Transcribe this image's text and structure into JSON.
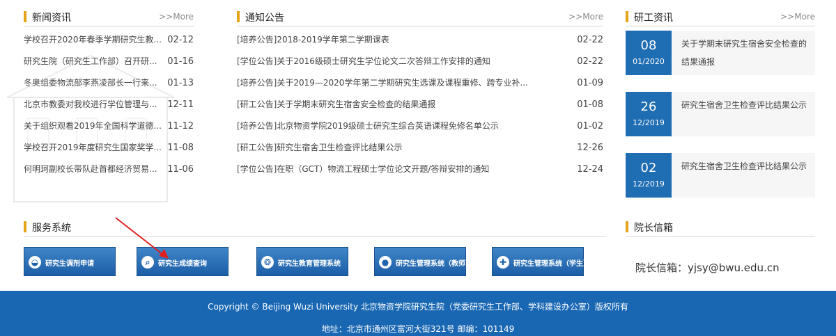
{
  "news": {
    "title": "新闻资讯",
    "more": ">>More",
    "items": [
      {
        "title": "学校召开2020年春季学期研究生教...",
        "date": "02-12"
      },
      {
        "title": "研究生院（研究生工作部）召开研...",
        "date": "01-16"
      },
      {
        "title": "冬奥组委物流部李燕凌部长一行来...",
        "date": "01-13"
      },
      {
        "title": "北京市教委对我校进行学位管理与...",
        "date": "12-11"
      },
      {
        "title": "关于组织观看2019年全国科学道德...",
        "date": "11-12"
      },
      {
        "title": "学校召开2019年度研究生国家奖学...",
        "date": "11-08"
      },
      {
        "title": "何明珂副校长带队赴首都经济贸易...",
        "date": "11-06"
      }
    ]
  },
  "notices": {
    "title": "通知公告",
    "more": ">>More",
    "items": [
      {
        "title": "[培养公告]2018-2019学年第二学期课表",
        "date": "02-22"
      },
      {
        "title": "[学位公告]关于2016级硕士研究生学位论文二次答辩工作安排的通知",
        "date": "02-22"
      },
      {
        "title": "[培养公告]关于2019—2020学年第二学期研究生选课及课程重修、跨专业补...",
        "date": "01-09"
      },
      {
        "title": "[研工公告]关于学期末研究生宿舍安全检查的结果通报",
        "date": "01-08"
      },
      {
        "title": "[培养公告]北京物资学院2019级硕士研究生综合英语课程免修名单公示",
        "date": "01-02"
      },
      {
        "title": "[研工公告]研究生宿舍卫生检查评比结果公示",
        "date": "12-26"
      },
      {
        "title": "[学位公告]在职（GCT）物流工程硕士学位论文开题/答辩安排的通知",
        "date": "12-24"
      }
    ]
  },
  "yangong": {
    "title": "研工资讯",
    "more": ">>More",
    "items": [
      {
        "day": "08",
        "ym": "01/2020",
        "text": "关于学期末研究生宿舍安全检查的结果通报"
      },
      {
        "day": "26",
        "ym": "12/2019",
        "text": "研究生宿舍卫生检查评比结果公示"
      },
      {
        "day": "02",
        "ym": "12/2019",
        "text": "研究生宿舍卫生检查评比结果公示"
      }
    ]
  },
  "services": {
    "title": "服务系统",
    "items": [
      {
        "label": "研究生调剂申请",
        "icon": "graduation-cap-icon",
        "glyph": "◒"
      },
      {
        "label": "研究生成绩查询",
        "icon": "search-icon",
        "glyph": "⌕"
      },
      {
        "label": "研究生教育管理系统",
        "icon": "aperture-icon",
        "glyph": "❂"
      },
      {
        "label": "研究生管理系统（教师）",
        "icon": "user-icon",
        "glyph": "●"
      },
      {
        "label": "研究生管理系统（学生）",
        "icon": "plus-circle-icon",
        "glyph": "✚"
      }
    ]
  },
  "mailbox": {
    "title": "院长信箱",
    "text": "院长信箱：yjsy@bwu.edu.cn"
  },
  "footer": {
    "copyright": "Copyright © Beijing Wuzi University 北京物资学院研究生院（党委研究生工作部、学科建设办公室）版权所有",
    "address": "地址：北京市通州区富河大街321号 邮编：101149"
  },
  "colors": {
    "accent": "#e6a418",
    "brand_blue": "#1f6db2",
    "footer_blue": "#1967b3",
    "arrow_red": "#e02020"
  }
}
